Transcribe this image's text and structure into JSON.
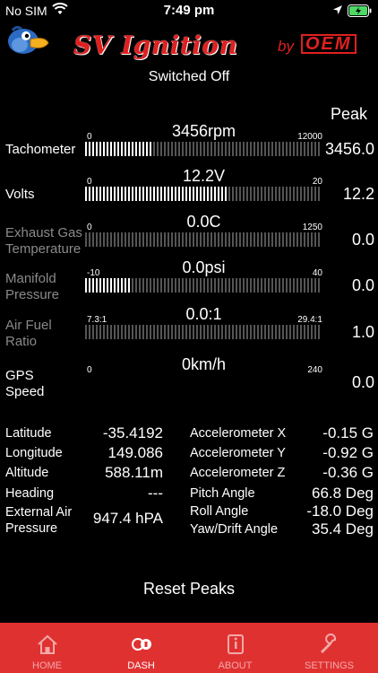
{
  "status_bar": {
    "carrier": "No SIM",
    "time": "7:49 pm"
  },
  "header": {
    "title": "SV Ignition",
    "by": "by",
    "brand": "OEM",
    "ignition_status": "Switched Off"
  },
  "peak_header": "Peak",
  "gauges": [
    {
      "label": "Tachometer",
      "label_lines": [
        "Tachometer"
      ],
      "min": "0",
      "max": "12000",
      "value": "3456rpm",
      "peak": "3456.0",
      "fill": 0.288,
      "active": true
    },
    {
      "label": "Volts",
      "label_lines": [
        "Volts"
      ],
      "min": "0",
      "max": "20",
      "value": "12.2V",
      "peak": "12.2",
      "fill": 0.61,
      "active": true
    },
    {
      "label": "Exhaust Gas Temperature",
      "label_lines": [
        "Exhaust Gas",
        "Temperature"
      ],
      "min": "0",
      "max": "1250",
      "value": "0.0C",
      "peak": "0.0",
      "fill": 0,
      "active": false
    },
    {
      "label": "Manifold Pressure",
      "label_lines": [
        "Manifold",
        "Pressure"
      ],
      "min": "-10",
      "max": "40",
      "value": "0.0psi",
      "peak": "0.0",
      "fill": 0.2,
      "active": false
    },
    {
      "label": "Air Fuel Ratio",
      "label_lines": [
        "Air Fuel",
        "Ratio"
      ],
      "min": "7.3:1",
      "max": "29.4:1",
      "value": "0.0:1",
      "peak": "1.0",
      "fill": 0,
      "active": false
    },
    {
      "label": "GPS Speed",
      "label_lines": [
        "GPS",
        "Speed"
      ],
      "min": "0",
      "max": "240",
      "value": "0km/h",
      "peak": "0.0",
      "fill": 0,
      "active": true,
      "no_bar": true
    }
  ],
  "left_data": [
    {
      "label_lines": [
        "Latitude"
      ],
      "value": "-35.4192"
    },
    {
      "label_lines": [
        "Longitude"
      ],
      "value": "149.086"
    },
    {
      "label_lines": [
        "Altitude"
      ],
      "value": "588.11m"
    },
    {
      "label_lines": [
        "Heading"
      ],
      "value": "---"
    },
    {
      "label_lines": [
        "External Air",
        "Pressure"
      ],
      "value": "947.4 hPA"
    }
  ],
  "right_data": [
    {
      "label": "Accelerometer X",
      "value": "-0.15 G"
    },
    {
      "label": "Accelerometer Y",
      "value": "-0.92 G"
    },
    {
      "label": "Accelerometer Z",
      "value": "-0.36 G"
    },
    {
      "label": "Pitch Angle",
      "value": "66.8 Deg"
    },
    {
      "label": "Roll Angle",
      "value": "-18.0 Deg"
    },
    {
      "label": "Yaw/Drift Angle",
      "value": "35.4 Deg"
    }
  ],
  "reset_label": "Reset Peaks",
  "tabs": [
    {
      "label": "HOME",
      "icon": "home-icon",
      "active": false
    },
    {
      "label": "DASH",
      "icon": "ignition-key-icon",
      "active": true
    },
    {
      "label": "ABOUT",
      "icon": "info-icon",
      "active": false
    },
    {
      "label": "SETTINGS",
      "icon": "wrench-icon",
      "active": false
    }
  ],
  "colors": {
    "accent": "#e03131",
    "brand_red": "#e02020",
    "tick_active": "#ffffff",
    "tick_inactive": "#555555",
    "label_dim": "#8a8a8a"
  }
}
